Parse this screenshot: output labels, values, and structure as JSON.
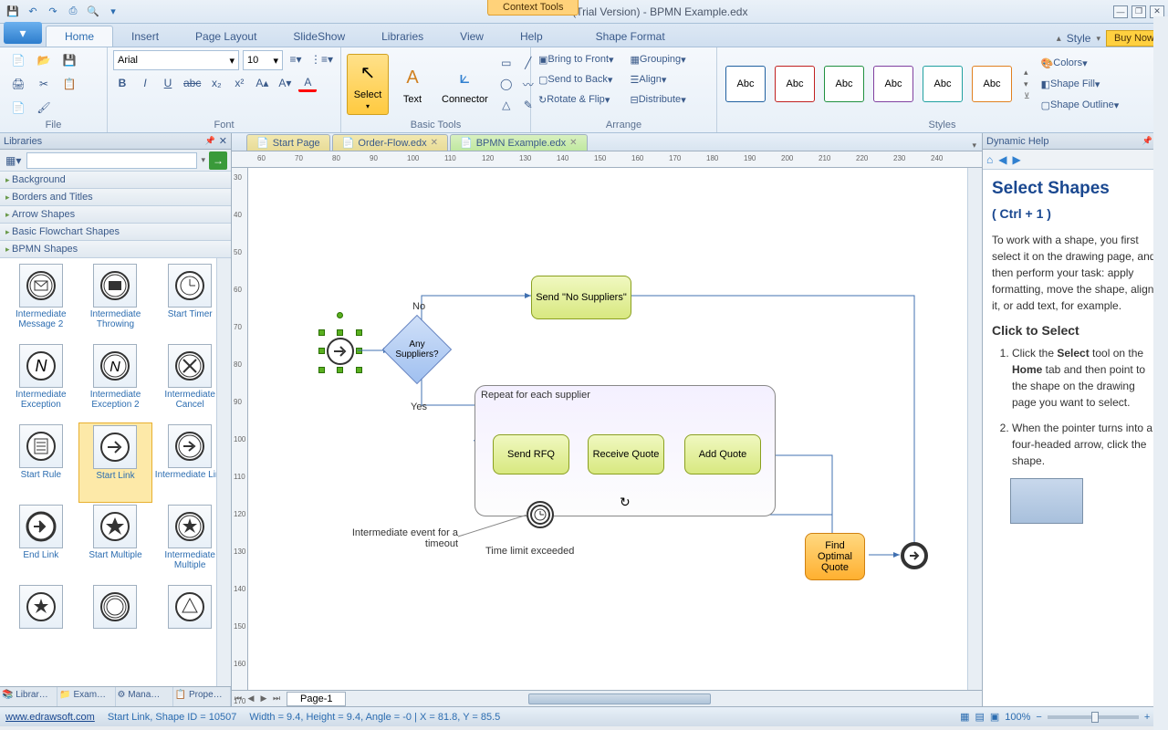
{
  "window": {
    "title": "Edraw Flowchart (Trial Version) - BPMN Example.edx",
    "context_tools": "Context Tools",
    "style_label": "Style",
    "buy_now": "Buy Now"
  },
  "tabs": {
    "home": "Home",
    "insert": "Insert",
    "page_layout": "Page Layout",
    "slideshow": "SlideShow",
    "libraries": "Libraries",
    "view": "View",
    "help": "Help",
    "shape_format": "Shape Format"
  },
  "ribbon": {
    "file_group": "File",
    "font_group": "Font",
    "font_name": "Arial",
    "font_size": "10",
    "basic_tools_group": "Basic Tools",
    "select_label": "Select",
    "text_label": "Text",
    "connector_label": "Connector",
    "arrange_group": "Arrange",
    "bring_front": "Bring to Front",
    "send_back": "Send to Back",
    "rotate_flip": "Rotate & Flip",
    "grouping": "Grouping",
    "align": "Align",
    "distribute": "Distribute",
    "styles_group": "Styles",
    "style_sample": "Abc",
    "colors": "Colors",
    "shape_fill": "Shape Fill",
    "shape_outline": "Shape Outline"
  },
  "libraries": {
    "title": "Libraries",
    "categories": [
      "Background",
      "Borders and Titles",
      "Arrow Shapes",
      "Basic Flowchart Shapes",
      "BPMN Shapes"
    ],
    "shapes": [
      {
        "label": "Intermediate Message 2"
      },
      {
        "label": "Intermediate Throwing"
      },
      {
        "label": "Start Timer"
      },
      {
        "label": "Intermediate Exception"
      },
      {
        "label": "Intermediate Exception 2"
      },
      {
        "label": "Intermediate Cancel"
      },
      {
        "label": "Start Rule"
      },
      {
        "label": "Start Link"
      },
      {
        "label": "Intermediate Link"
      },
      {
        "label": "End Link"
      },
      {
        "label": "Start Multiple"
      },
      {
        "label": "Intermediate Multiple"
      }
    ],
    "selected_shape_index": 7,
    "bottom_tabs": [
      "Librar…",
      "Exam…",
      "Mana…",
      "Prope…"
    ]
  },
  "doc_tabs": {
    "start_page": "Start Page",
    "order_flow": "Order-Flow.edx",
    "bpmn_example": "BPMN Example.edx"
  },
  "canvas": {
    "ruler_h": [
      "60",
      "70",
      "80",
      "90",
      "100",
      "110",
      "120",
      "130",
      "140",
      "150",
      "160",
      "170",
      "180",
      "190",
      "200",
      "210",
      "220",
      "230",
      "240"
    ],
    "ruler_v": [
      "30",
      "40",
      "50",
      "60",
      "70",
      "80",
      "90",
      "100",
      "110",
      "120",
      "130",
      "140",
      "150",
      "160",
      "170"
    ],
    "gateway_text": "Any Suppliers?",
    "label_no": "No",
    "label_yes": "Yes",
    "task_no_suppliers": "Send \"No Suppliers\"",
    "group_label": "Repeat for each supplier",
    "task_send_rfq": "Send RFQ",
    "task_receive_quote": "Receive Quote",
    "task_add_quote": "Add Quote",
    "timeout_note": "Intermediate event for a timeout",
    "time_limit": "Time limit exceeded",
    "task_find_optimal": "Find Optimal Quote",
    "page_tab": "Page-1"
  },
  "help": {
    "title": "Dynamic Help",
    "heading": "Select Shapes",
    "shortcut": "( Ctrl + 1 )",
    "intro": "To work with a shape, you first select it on the drawing page, and then perform your task: apply formatting, move the shape, align it, or add text, for example.",
    "sub": "Click to Select",
    "step1_a": "Click the ",
    "step1_b": "Select",
    "step1_c": " tool on the ",
    "step1_d": "Home",
    "step1_e": " tab and then point to the shape on the drawing page you want to select.",
    "step2": "When the pointer turns into a four-headed arrow, click the shape."
  },
  "status": {
    "url": "www.edrawsoft.com",
    "shape_info": "Start Link, Shape ID = 10507",
    "dims": "Width = 9.4, Height = 9.4, Angle = -0 | X = 81.8, Y = 85.5",
    "zoom": "100%"
  }
}
